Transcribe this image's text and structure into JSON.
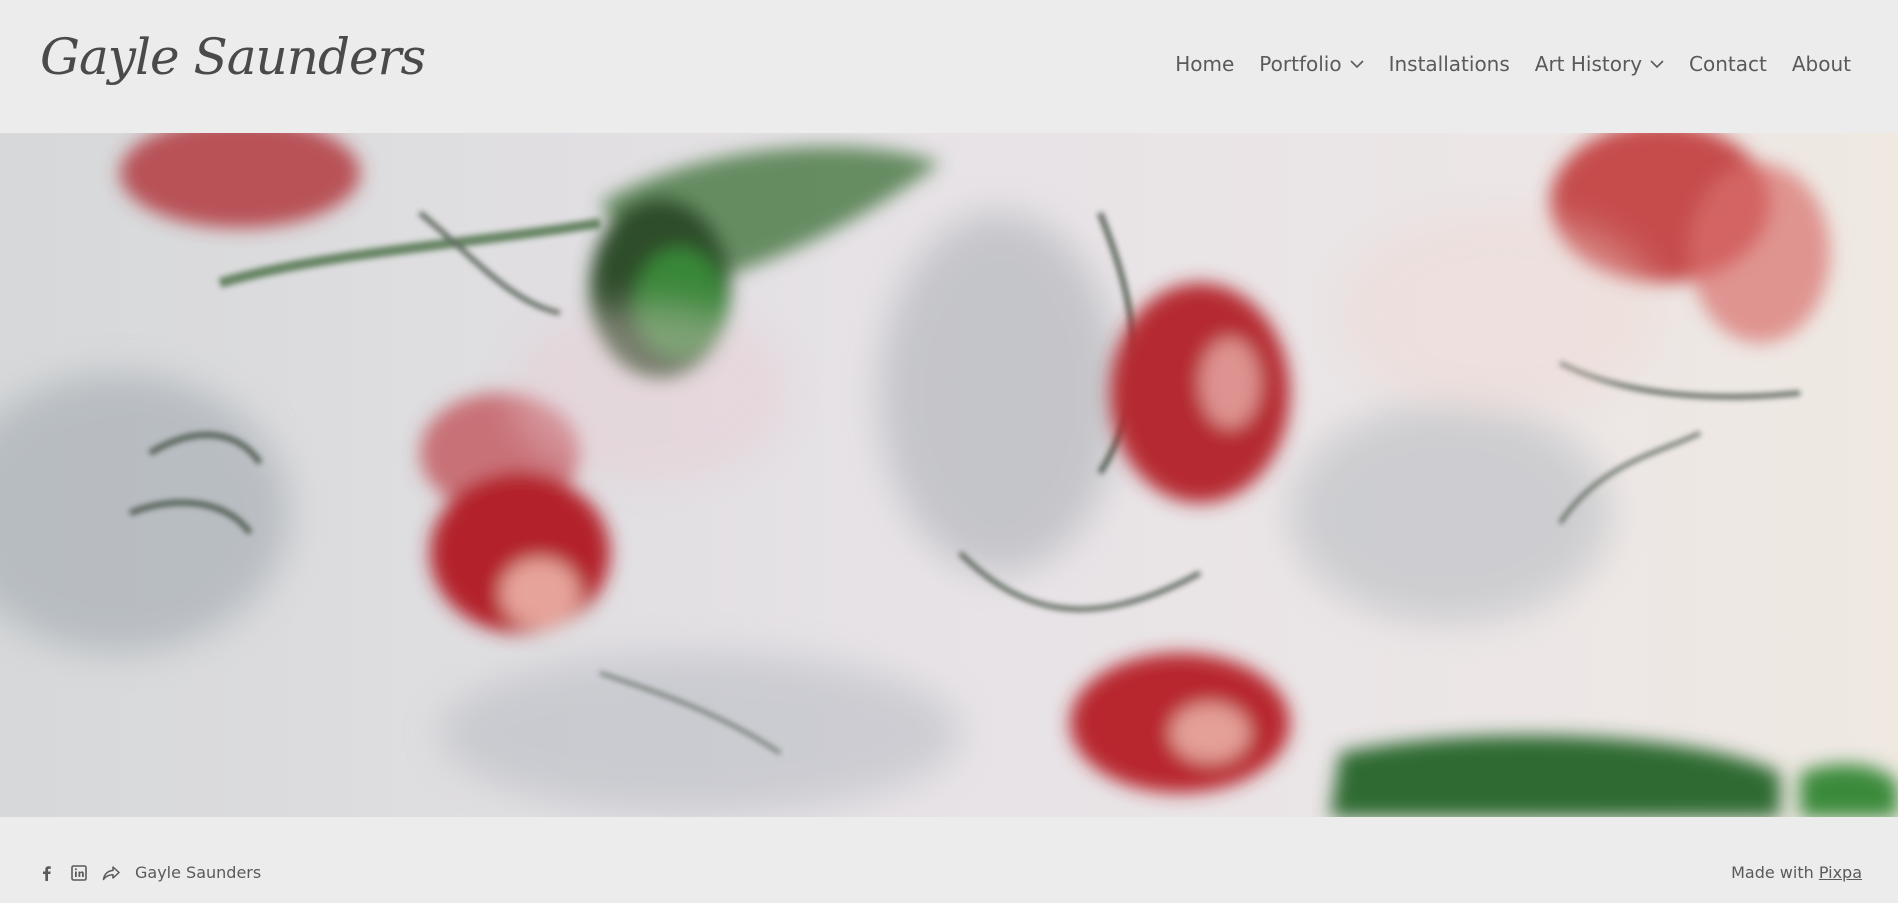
{
  "site": {
    "logo_text": "Gayle Saunders"
  },
  "nav": {
    "items": [
      {
        "label": "Home",
        "has_dropdown": false
      },
      {
        "label": "Portfolio",
        "has_dropdown": true
      },
      {
        "label": "Installations",
        "has_dropdown": false
      },
      {
        "label": "Art History",
        "has_dropdown": true
      },
      {
        "label": "Contact",
        "has_dropdown": false
      },
      {
        "label": "About",
        "has_dropdown": false
      }
    ]
  },
  "hero": {
    "image_icon": "hero-photo-blurred-red-flowers"
  },
  "footer": {
    "social_icons": [
      "facebook-icon",
      "linkedin-icon",
      "share-icon"
    ],
    "name": "Gayle Saunders",
    "made_with_prefix": "Made with",
    "made_with_link": "Pixpa"
  },
  "colors": {
    "background": "#ececec",
    "text": "#5a5a5a"
  }
}
